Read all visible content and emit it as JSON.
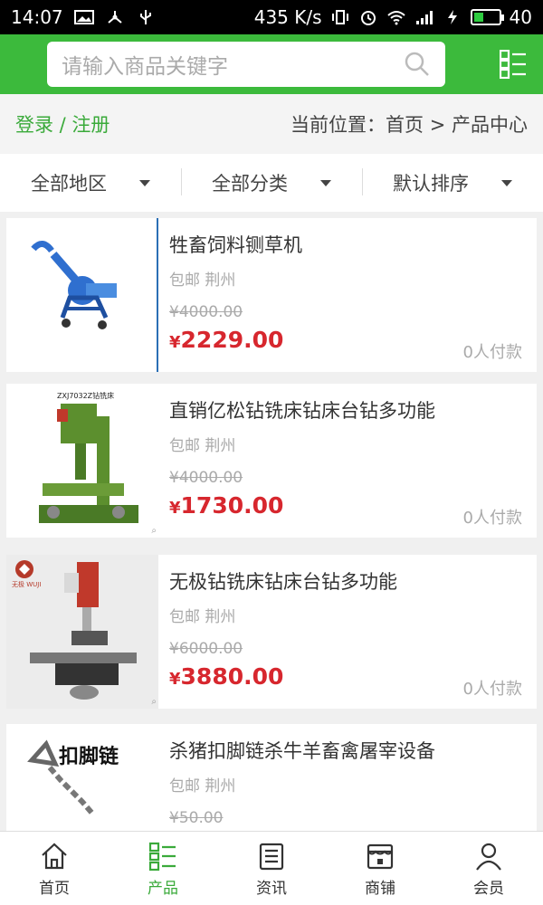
{
  "status_bar": {
    "time": "14:07",
    "speed": "435 K/s",
    "battery": "40",
    "battery_level": 0.4
  },
  "header": {
    "search_placeholder": "请输入商品关键字",
    "search_icon": "search-icon",
    "menu_icon": "grid-list-icon"
  },
  "breadcrumb": {
    "login": "登录 / 注册",
    "position": "当前位置：首页 > 产品中心"
  },
  "filters": [
    {
      "label": "全部地区"
    },
    {
      "label": "全部分类"
    },
    {
      "label": "默认排序"
    }
  ],
  "products": [
    {
      "name": "牲畜饲料铡草机",
      "location": "包邮 荆州",
      "old_price": "¥4000.00",
      "price_symbol": "¥",
      "price": "2229.00",
      "paid": "0人付款"
    },
    {
      "name": "直销亿松钻铣床钻床台钻多功能",
      "location": "包邮 荆州",
      "old_price": "¥4000.00",
      "price_symbol": "¥",
      "price": "1730.00",
      "paid": "0人付款",
      "img_caption": "ZXJ7032Z钻铣床"
    },
    {
      "name": "无极钻铣床钻床台钻多功能",
      "location": "包邮 荆州",
      "old_price": "¥6000.00",
      "price_symbol": "¥",
      "price": "3880.00",
      "paid": "0人付款",
      "img_caption": "无极 WUJI"
    },
    {
      "name": "杀猪扣脚链杀牛羊畜禽屠宰设备",
      "location": "包邮 荆州",
      "old_price": "¥50.00",
      "price_symbol": "¥",
      "price": "",
      "paid": "",
      "img_caption": "扣脚链"
    }
  ],
  "tabbar": [
    {
      "label": "首页",
      "icon": "home-icon"
    },
    {
      "label": "产品",
      "icon": "product-list-icon",
      "active": true
    },
    {
      "label": "资讯",
      "icon": "news-icon"
    },
    {
      "label": "商铺",
      "icon": "shop-icon"
    },
    {
      "label": "会员",
      "icon": "user-icon"
    }
  ],
  "colors": {
    "accent": "#3cba3c",
    "price": "#d7272e"
  }
}
